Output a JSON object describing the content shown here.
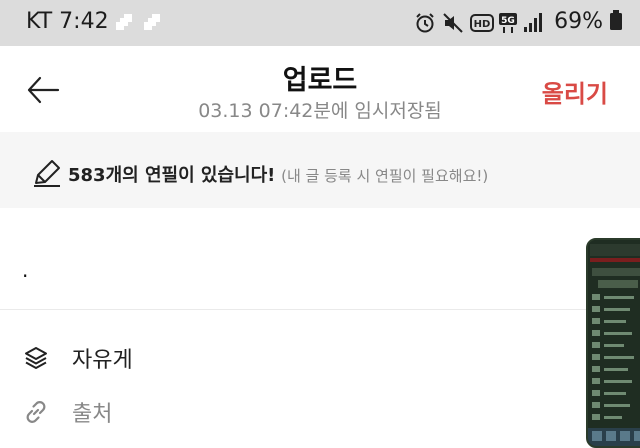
{
  "status_bar": {
    "carrier": "KT",
    "time": "7:42",
    "battery": "69%",
    "icons": [
      "alarm-icon",
      "mute-icon",
      "hd-icon",
      "5g-icon",
      "signal-icon",
      "battery-icon"
    ]
  },
  "header": {
    "back_icon": "arrow-left-icon",
    "title": "업로드",
    "subtitle": "03.13 07:42분에 임시저장됨",
    "upload_label": "올리기",
    "upload_color": "#d94a45"
  },
  "pencil_bar": {
    "icon": "pencil-icon",
    "count_text": "583개의 연필이 있습니다!",
    "note": "(내 글 등록 시 연필이 필요해요!)"
  },
  "editor": {
    "content": "."
  },
  "options": [
    {
      "icon": "layers-icon",
      "label": "자유게"
    },
    {
      "icon": "link-icon",
      "label": "출처"
    }
  ]
}
